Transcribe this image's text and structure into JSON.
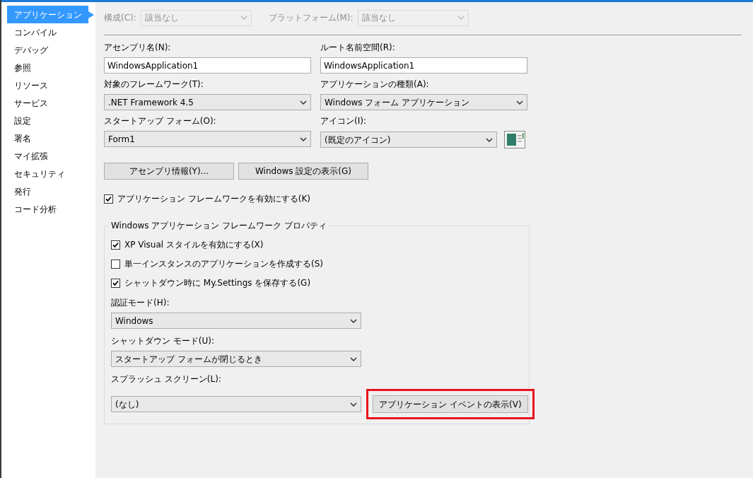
{
  "sidebar": {
    "items": [
      {
        "label": "アプリケーション",
        "selected": true
      },
      {
        "label": "コンパイル",
        "selected": false
      },
      {
        "label": "デバッグ",
        "selected": false
      },
      {
        "label": "参照",
        "selected": false
      },
      {
        "label": "リソース",
        "selected": false
      },
      {
        "label": "サービス",
        "selected": false
      },
      {
        "label": "設定",
        "selected": false
      },
      {
        "label": "署名",
        "selected": false
      },
      {
        "label": "マイ拡張",
        "selected": false
      },
      {
        "label": "セキュリティ",
        "selected": false
      },
      {
        "label": "発行",
        "selected": false
      },
      {
        "label": "コード分析",
        "selected": false
      }
    ]
  },
  "config_bar": [
    {
      "label": "構成(C):",
      "value": "該当なし",
      "disabled": true
    },
    {
      "label": "プラットフォーム(M):",
      "value": "該当なし",
      "disabled": true
    }
  ],
  "fields": [
    {
      "kind": "text",
      "label": "アセンブリ名(N):",
      "value": "WindowsApplication1"
    },
    {
      "kind": "text",
      "label": "ルート名前空間(R):",
      "value": "WindowsApplication1"
    },
    {
      "kind": "select",
      "label": "対象のフレームワーク(T):",
      "value": ".NET Framework 4.5"
    },
    {
      "kind": "select",
      "label": "アプリケーションの種類(A):",
      "value": "Windows フォーム アプリケーション"
    },
    {
      "kind": "select",
      "label": "スタートアップ フォーム(O):",
      "value": "Form1"
    },
    {
      "kind": "icon_select",
      "label": "アイコン(I):",
      "value": "(既定のアイコン)"
    }
  ],
  "buttons": [
    "アセンブリ情報(Y)...",
    "Windows 設定の表示(G)"
  ],
  "enable_framework": {
    "label": "アプリケーション フレームワークを有効にする(K)",
    "checked": true
  },
  "framework_group": {
    "title": "Windows アプリケーション フレームワーク プロパティ",
    "options": [
      {
        "label": "XP Visual スタイルを有効にする(X)",
        "checked": true
      },
      {
        "label": "単一インスタンスのアプリケーションを作成する(S)",
        "checked": false
      },
      {
        "label": "シャットダウン時に My.Settings を保存する(G)",
        "checked": true
      }
    ],
    "selects": [
      {
        "label": "認証モード(H):",
        "value": "Windows"
      },
      {
        "label": "シャットダウン モード(U):",
        "value": "スタートアップ フォームが閉じるとき"
      },
      {
        "label": "スプラッシュ スクリーン(L):",
        "value": "(なし)"
      }
    ],
    "event_button": {
      "label": "アプリケーション イベントの表示(V)",
      "highlighted": true
    }
  }
}
